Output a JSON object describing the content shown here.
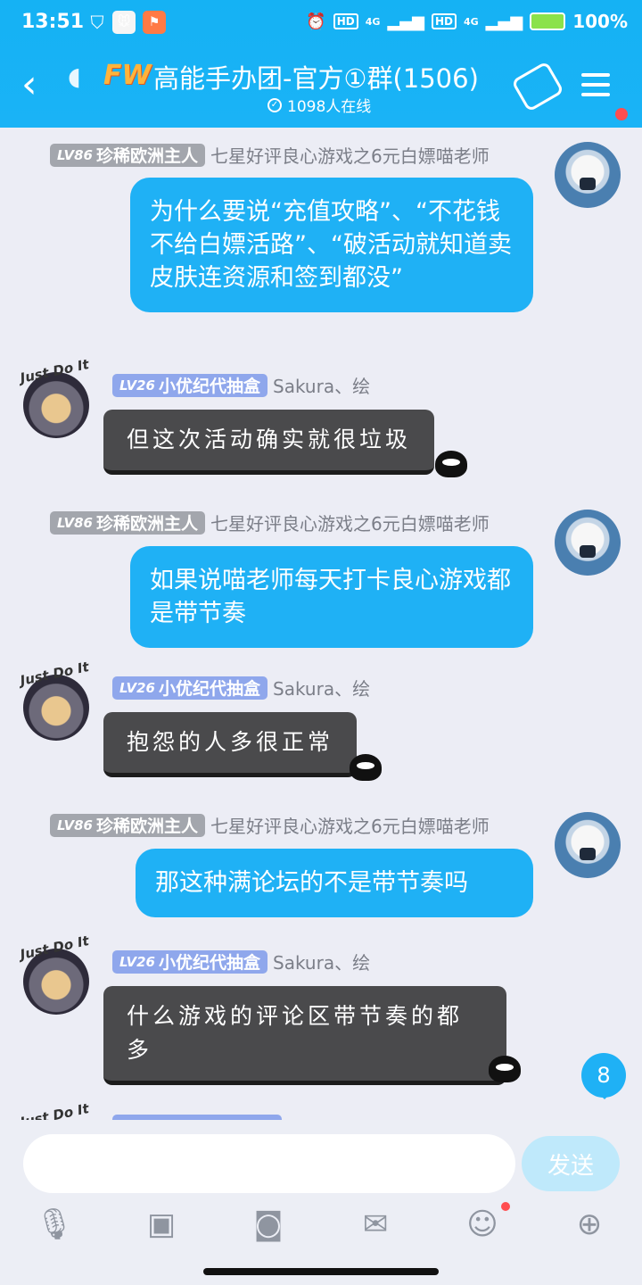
{
  "status_bar": {
    "time": "13:51",
    "battery": "100%",
    "network_1": "4G",
    "network_2": "4G",
    "hd_1": "HD",
    "hd_2": "HD"
  },
  "header": {
    "group_name": "高能手办团-官方①群(1506)",
    "logo_text": "FW",
    "online": "1098人在线"
  },
  "messages": [
    {
      "side": "right",
      "level": "LV86",
      "title": "珍稀欧洲主人",
      "sender": "七星好评良心游戏之6元白嫖喵老师",
      "text": "为什么要说“充值攻略”、“不花钱不给白嫖活路”、“破活动就知道卖皮肤连资源和签到都没”"
    },
    {
      "side": "left",
      "level": "LV26",
      "title": "小优纪代抽盒",
      "sender": "Sakura、绘",
      "text": "但这次活动确实就很垃圾"
    },
    {
      "side": "right",
      "level": "LV86",
      "title": "珍稀欧洲主人",
      "sender": "七星好评良心游戏之6元白嫖喵老师",
      "text": "如果说喵老师每天打卡良心游戏都是带节奏"
    },
    {
      "side": "left",
      "level": "LV26",
      "title": "小优纪代抽盒",
      "sender": "Sakura、绘",
      "text": "抱怨的人多很正常"
    },
    {
      "side": "right",
      "level": "LV86",
      "title": "珍稀欧洲主人",
      "sender": "七星好评良心游戏之6元白嫖喵老师",
      "text": "那这种满论坛的不是带节奏吗"
    },
    {
      "side": "left",
      "level": "LV26",
      "title": "小优纪代抽盒",
      "sender": "Sakura、绘",
      "text": "什么游戏的评论区带节奏的都多"
    }
  ],
  "avatar_tag": "Just Do It",
  "unread_count": "8",
  "composer": {
    "send_label": "发送",
    "input_value": ""
  },
  "toolbar": {
    "icons": [
      "microphone-icon",
      "image-icon",
      "camera-icon",
      "red-packet-icon",
      "emoji-icon",
      "plus-icon"
    ]
  },
  "colors": {
    "header": "#1ab3f6",
    "bubble_self": "#1fb1f5",
    "bubble_other": "#4a4a4c",
    "background": "#ecedf5"
  }
}
